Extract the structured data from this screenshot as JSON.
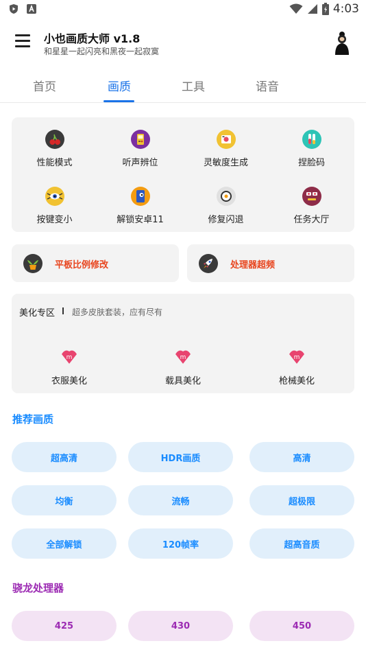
{
  "status_bar": {
    "time": "4:03"
  },
  "app": {
    "title": "小也画质大师 v1.8",
    "subtitle": "和星星一起闪亮和黑夜一起寂寞"
  },
  "tabs": [
    {
      "label": "首页",
      "active": false
    },
    {
      "label": "画质",
      "active": true
    },
    {
      "label": "工具",
      "active": false
    },
    {
      "label": "语音",
      "active": false
    }
  ],
  "grid": [
    {
      "label": "性能模式",
      "icon": "cherry-icon"
    },
    {
      "label": "听声辨位",
      "icon": "gameboy-icon"
    },
    {
      "label": "灵敏度生成",
      "icon": "camera-icon"
    },
    {
      "label": "捏脸码",
      "icon": "test-tubes-icon"
    },
    {
      "label": "按键变小",
      "icon": "eye-spider-icon"
    },
    {
      "label": "解锁安卓11",
      "icon": "android-phone-icon"
    },
    {
      "label": "修复闪退",
      "icon": "sushi-icon"
    },
    {
      "label": "任务大厅",
      "icon": "robot-face-icon"
    }
  ],
  "wide_cards": [
    {
      "label": "平板比例修改",
      "icon": "plant-pot-icon"
    },
    {
      "label": "处理器超频",
      "icon": "rocket-icon"
    }
  ],
  "beauty": {
    "title": "美化专区",
    "subtitle": "超多皮肤套装，应有尽有",
    "items": [
      {
        "label": "衣服美化",
        "icon": "m-logo-icon"
      },
      {
        "label": "载具美化",
        "icon": "m-logo-icon"
      },
      {
        "label": "枪械美化",
        "icon": "m-logo-icon"
      }
    ]
  },
  "recommended": {
    "title": "推荐画质",
    "title_color": "#1a8cff",
    "options": [
      "超高清",
      "HDR画质",
      "高清",
      "均衡",
      "流畅",
      "超极限",
      "全部解锁",
      "120帧率",
      "超高音质"
    ]
  },
  "snapdragon": {
    "title": "骁龙处理器",
    "title_color": "#9c2bb3",
    "options": [
      "425",
      "430",
      "450"
    ]
  }
}
